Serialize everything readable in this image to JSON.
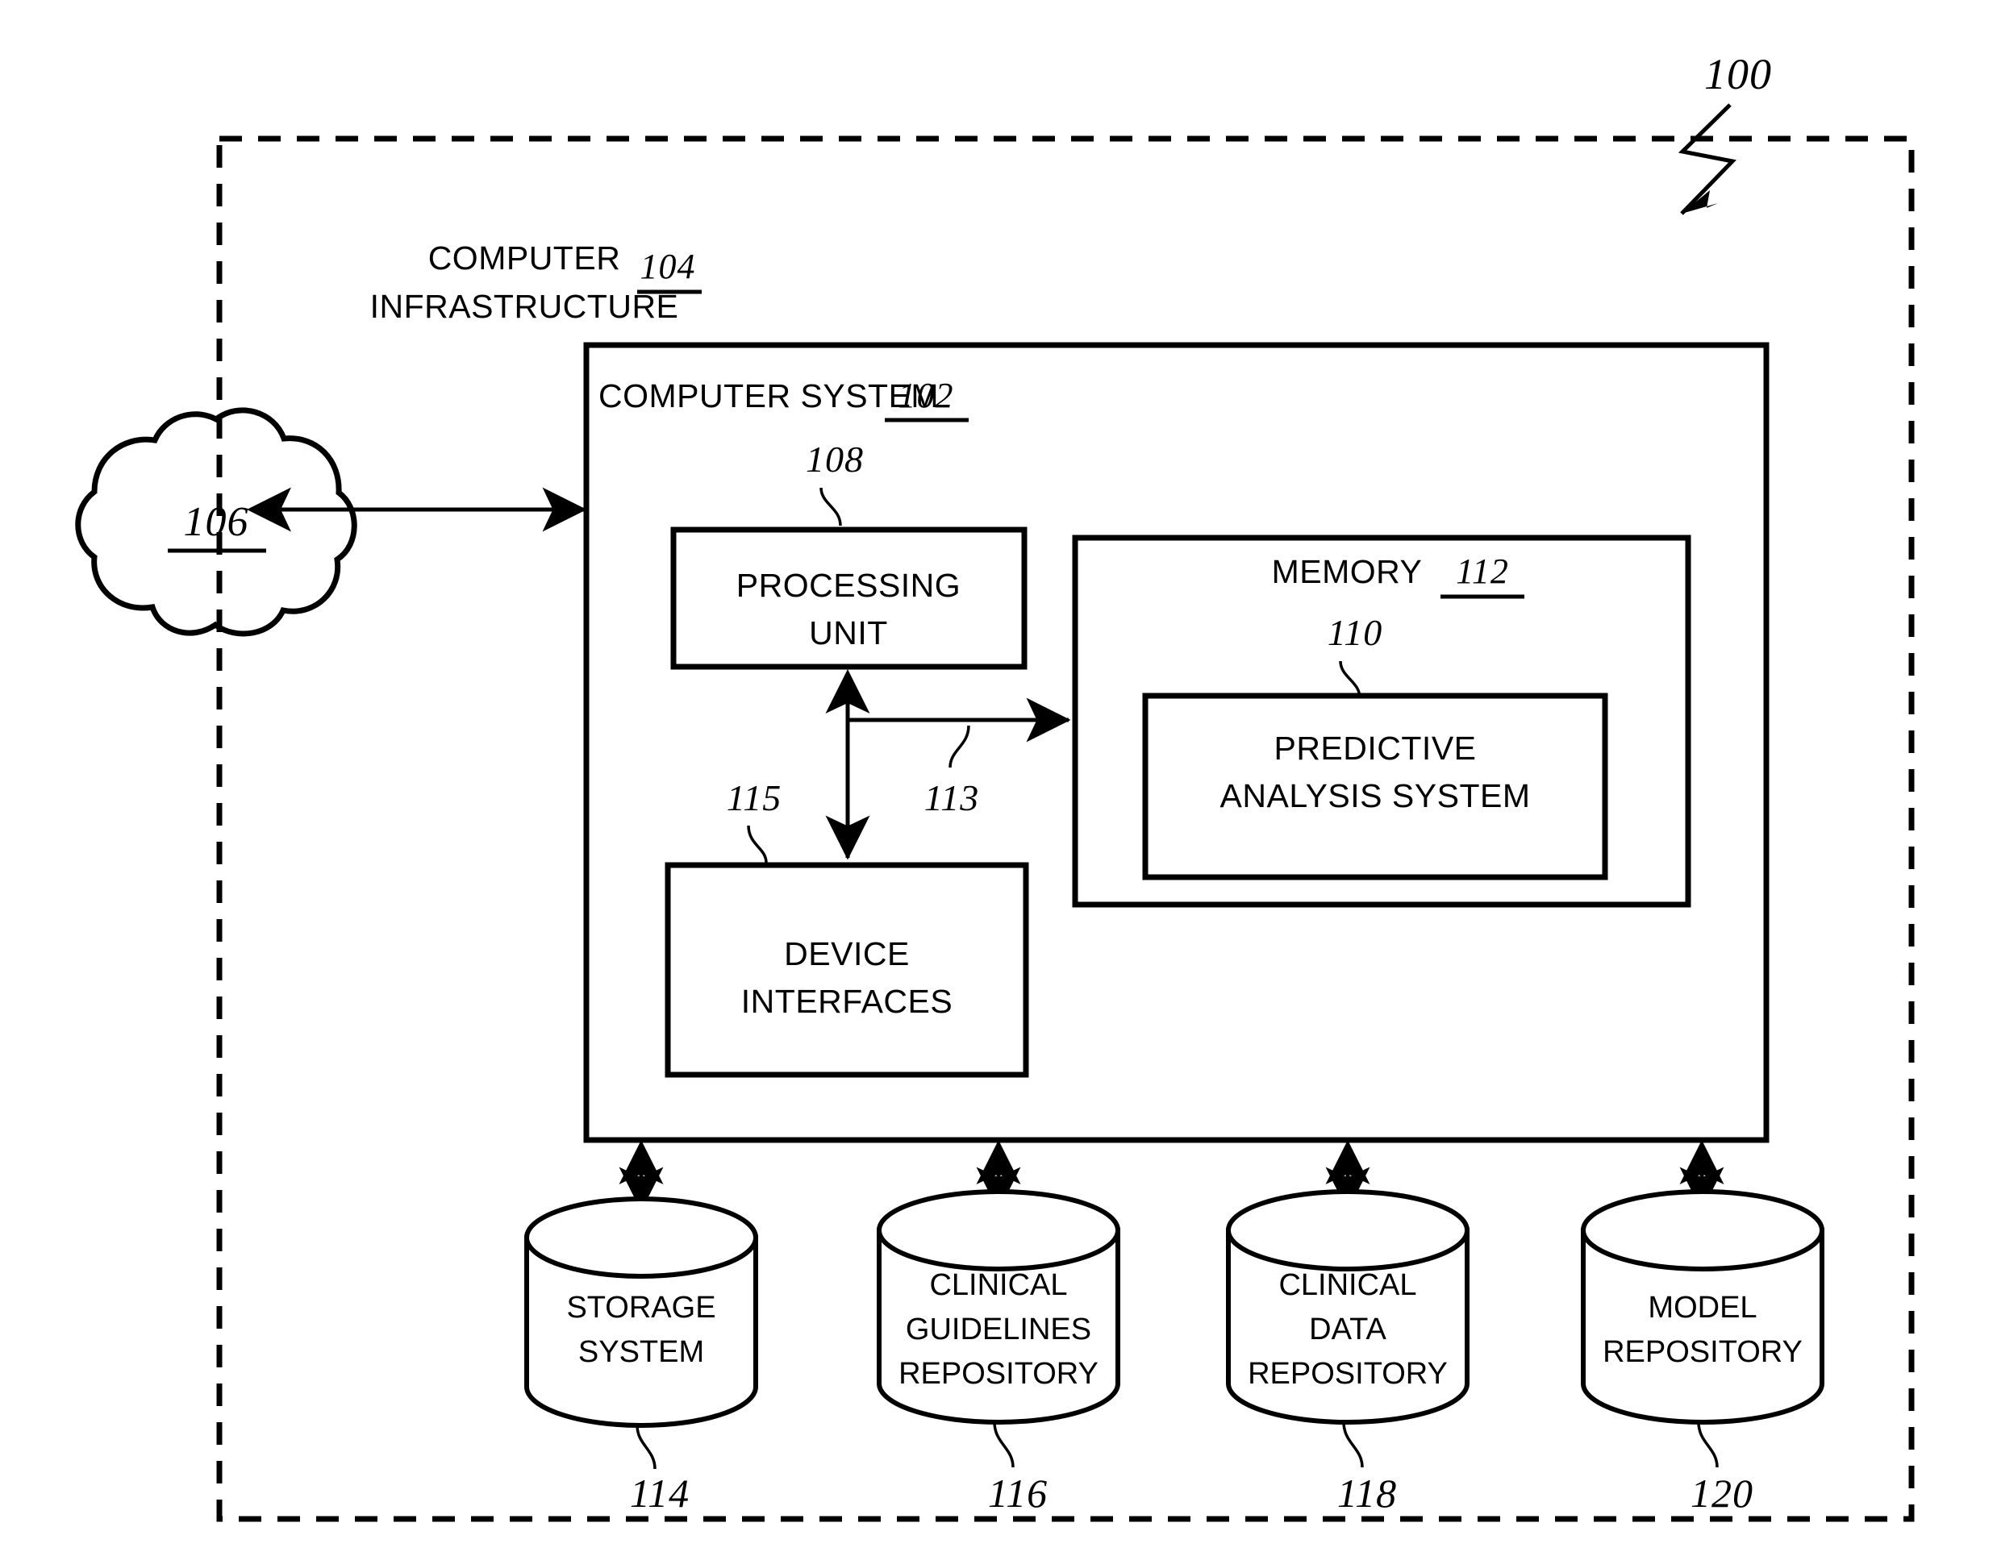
{
  "figure": {
    "figure_ref": "100",
    "background_color": "#ffffff",
    "line_color": "#000000"
  },
  "outer_boundary": {
    "title_line1": "COMPUTER",
    "title_line2": "INFRASTRUCTURE",
    "ref": "104",
    "style": "dashed"
  },
  "network_cloud": {
    "ref": "106",
    "shape": "cloud",
    "connector": "double-headed-arrow"
  },
  "computer_system": {
    "title": "COMPUTER SYSTEM",
    "ref": "102"
  },
  "processing_unit": {
    "line1": "PROCESSING",
    "line2": "UNIT",
    "ref": "108"
  },
  "bus": {
    "ref": "113"
  },
  "device_interfaces": {
    "line1": "DEVICE",
    "line2": "INTERFACES",
    "ref": "115"
  },
  "memory": {
    "title": "MEMORY",
    "ref": "112",
    "inner": {
      "line1": "PREDICTIVE",
      "line2": "ANALYSIS SYSTEM",
      "ref": "110"
    }
  },
  "repositories": [
    {
      "id": "storage-system",
      "lines": [
        "STORAGE",
        "SYSTEM"
      ],
      "ref": "114"
    },
    {
      "id": "clinical-guidelines-repository",
      "lines": [
        "CLINICAL",
        "GUIDELINES",
        "REPOSITORY"
      ],
      "ref": "116"
    },
    {
      "id": "clinical-data-repository",
      "lines": [
        "CLINICAL",
        "DATA",
        "REPOSITORY"
      ],
      "ref": "118"
    },
    {
      "id": "model-repository",
      "lines": [
        "MODEL",
        "REPOSITORY"
      ],
      "ref": "120"
    }
  ]
}
